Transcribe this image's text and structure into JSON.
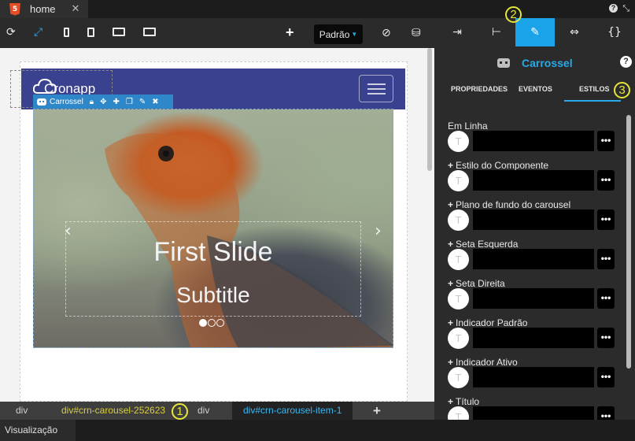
{
  "tab": {
    "title": "home",
    "icon": "html5-icon",
    "close": "✕"
  },
  "top_controls": {
    "help": "?",
    "minimize": "⤡"
  },
  "toolbar": {
    "icons": [
      "refresh-icon",
      "fullscreen-icon",
      "phone-icon",
      "tablet-icon",
      "desktop-icon",
      "monitor-icon"
    ],
    "add_label": "+",
    "theme_select": "Padrão",
    "right_icons": [
      "hide-icon",
      "database-icon"
    ]
  },
  "canvas": {
    "logo_text": "Cronapp",
    "component_toolbar_label": "Carrossel",
    "slide_title": "First Slide",
    "slide_subtitle": "Subtitle"
  },
  "breadcrumb": {
    "items": [
      "div",
      "div#crn-carousel-252623",
      "div",
      "div#crn-carousel-item-1"
    ],
    "add": "+"
  },
  "status": {
    "tab": "Visualização"
  },
  "panel": {
    "top_tabs": [
      "import-icon",
      "tree-icon",
      "brush-icon",
      "resize-icon",
      "code-icon"
    ],
    "component_name": "Carrossel",
    "help": "?",
    "subtabs": [
      "PROPRIEDADES",
      "EVENTOS",
      "ESTILOS"
    ],
    "properties": [
      {
        "label": "Em Linha",
        "plus": false
      },
      {
        "label": "Estilo do Componente",
        "plus": true
      },
      {
        "label": "Plano de fundo do carousel",
        "plus": true
      },
      {
        "label": "Seta Esquerda",
        "plus": true
      },
      {
        "label": "Seta Direita",
        "plus": true
      },
      {
        "label": "Indicador Padrão",
        "plus": true
      },
      {
        "label": "Indicador Ativo",
        "plus": true
      },
      {
        "label": "Título",
        "plus": true
      }
    ],
    "t_label": "T",
    "more": "•••"
  },
  "annotations": [
    "1",
    "2",
    "3"
  ],
  "colors": {
    "accent": "#1aa3e8",
    "navbar": "#3a418e",
    "annotation": "#e6e63a",
    "crumb_yellow": "#d9cf3a"
  }
}
